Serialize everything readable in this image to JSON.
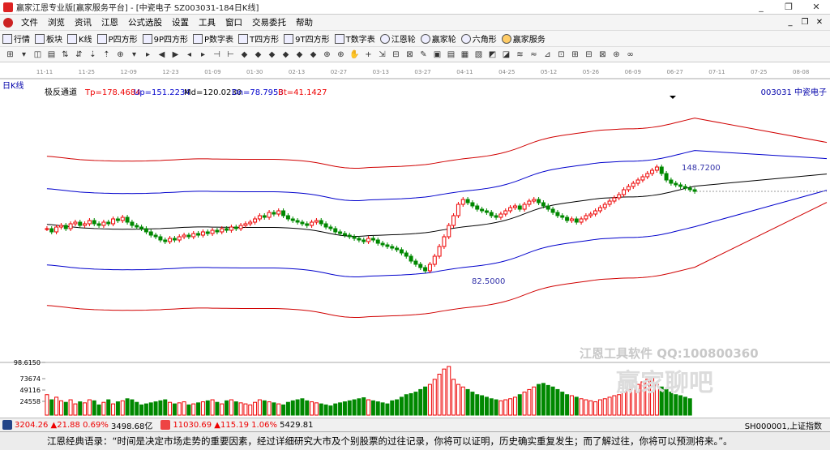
{
  "window": {
    "title": "赢家江恩专业版[赢家服务平台] - [中瓷电子  SZ003031-184日K线]",
    "controls": [
      "_",
      "❐",
      "✕"
    ]
  },
  "menu": {
    "items": [
      "文件",
      "浏览",
      "资讯",
      "江恩",
      "公式选股",
      "设置",
      "工具",
      "窗口",
      "交易委托",
      "帮助"
    ],
    "mdi": [
      "_",
      "❐",
      "✕"
    ]
  },
  "toolbar1": {
    "items": [
      {
        "label": "行情",
        "icon": "grid-icon"
      },
      {
        "label": "板块",
        "icon": "blocks-icon"
      },
      {
        "label": "K线",
        "icon": "candle-icon"
      },
      {
        "label": "P四方形",
        "icon": "p-square-icon"
      },
      {
        "label": "9P四方形",
        "icon": "9p-square-icon"
      },
      {
        "label": "P数字表",
        "icon": "p-table-icon"
      },
      {
        "label": "T四方形",
        "icon": "t-square-icon"
      },
      {
        "label": "9T四方形",
        "icon": "9t-square-icon"
      },
      {
        "label": "T数字表",
        "icon": "t-table-icon"
      },
      {
        "label": "江恩轮",
        "icon": "gann-wheel-icon"
      },
      {
        "label": "赢家轮",
        "icon": "winner-wheel-icon"
      },
      {
        "label": "六角形",
        "icon": "hexagon-icon"
      },
      {
        "label": "赢家服务",
        "icon": "service-icon"
      }
    ]
  },
  "toolbar2": {
    "glyphs": [
      "⊞",
      "▾",
      "◫",
      "▤",
      "⇅",
      "⇵",
      "⇣",
      "⇡",
      "⊕",
      "▾",
      "▸",
      "◀",
      "▶",
      "◂",
      "▸",
      "⊣",
      "⊢",
      "◆",
      "◆",
      "◆",
      "◆",
      "◆",
      "◆",
      "⊕",
      "⊕",
      "✋",
      "+",
      "⇲",
      "⊟",
      "⊠",
      "✎",
      "▣",
      "▤",
      "▦",
      "▧",
      "◩",
      "◪",
      "≋",
      "≈",
      "⊿",
      "⊡",
      "⊞",
      "⊟",
      "⊠",
      "⊛",
      "∞"
    ]
  },
  "chart_data": {
    "type": "candlestick",
    "period_label": "日K线",
    "indicator": {
      "name": "极反通道",
      "tp": "Tp=178.4684",
      "up": "Up=151.2234",
      "md": "Md=120.0230",
      "dn": "Dn=78.7953",
      "bt": "Bt=41.1427"
    },
    "stock_label": "003031 中瓷电子",
    "x_ticks": [
      "11-11",
      "11-25",
      "12-09",
      "12-23",
      "01-09",
      "01-30",
      "02-13",
      "02-27",
      "03-13",
      "03-27",
      "04-11",
      "04-25",
      "05-12",
      "05-26",
      "06-09",
      "06-27",
      "07-11",
      "07-25",
      "08-08"
    ],
    "annotations": {
      "high": "148.7200",
      "low": "82.5000"
    },
    "volume_scale": [
      "98.6150",
      "73674",
      "49116",
      "24558"
    ],
    "ylim": [
      30,
      190
    ],
    "closes": [
      110,
      108,
      111,
      112,
      110,
      113,
      114,
      112,
      113,
      115,
      113,
      112,
      114,
      113,
      116,
      115,
      117,
      114,
      112,
      111,
      110,
      108,
      106,
      105,
      103,
      102,
      104,
      103,
      105,
      106,
      105,
      107,
      106,
      108,
      107,
      109,
      108,
      110,
      109,
      111,
      110,
      112,
      113,
      114,
      116,
      118,
      117,
      120,
      119,
      121,
      118,
      116,
      115,
      114,
      113,
      112,
      114,
      115,
      113,
      111,
      110,
      108,
      107,
      106,
      105,
      104,
      103,
      102,
      104,
      103,
      101,
      100,
      99,
      98,
      97,
      95,
      93,
      90,
      88,
      86,
      84,
      88,
      93,
      99,
      105,
      112,
      118,
      125,
      128,
      126,
      124,
      122,
      121,
      120,
      118,
      117,
      119,
      121,
      123,
      124,
      122,
      125,
      127,
      128,
      126,
      124,
      122,
      120,
      118,
      117,
      115,
      116,
      114,
      116,
      118,
      119,
      121,
      123,
      125,
      127,
      129,
      131,
      134,
      136,
      138,
      140,
      142,
      144,
      146,
      148,
      144,
      140,
      138,
      137,
      136,
      135,
      134,
      133
    ],
    "volumes": [
      40,
      30,
      35,
      28,
      25,
      30,
      22,
      26,
      24,
      30,
      28,
      20,
      25,
      30,
      22,
      26,
      28,
      32,
      30,
      25,
      20,
      22,
      24,
      26,
      28,
      30,
      25,
      22,
      24,
      26,
      20,
      22,
      24,
      26,
      28,
      30,
      25,
      22,
      28,
      30,
      26,
      24,
      22,
      20,
      25,
      30,
      28,
      26,
      24,
      22,
      20,
      25,
      28,
      30,
      32,
      28,
      26,
      24,
      22,
      20,
      18,
      22,
      24,
      26,
      28,
      30,
      32,
      34,
      30,
      28,
      26,
      24,
      22,
      28,
      30,
      35,
      40,
      42,
      45,
      50,
      55,
      60,
      70,
      80,
      90,
      95,
      70,
      60,
      55,
      50,
      45,
      40,
      38,
      35,
      32,
      30,
      28,
      30,
      32,
      35,
      40,
      45,
      50,
      55,
      60,
      62,
      58,
      55,
      50,
      45,
      40,
      38,
      35,
      32,
      30,
      28,
      26,
      30,
      32,
      35,
      38,
      40,
      45,
      50,
      55,
      60,
      65,
      70,
      75,
      60,
      55,
      50,
      45,
      40,
      38,
      35,
      32
    ]
  },
  "status": {
    "sh_value": "3204.26",
    "sh_change": "▲21.88",
    "sh_pct": "0.69%",
    "sh_amount": "3498.68亿",
    "sz_value": "11030.69",
    "sz_change": "▲115.19",
    "sz_pct": "1.06%",
    "sz_amount": "5429.81",
    "right_label": "SH000001,上证指数"
  },
  "watermark": {
    "line1": "江恩工具软件  QQ:100800360",
    "line2": "赢家聊吧"
  },
  "quote_bar": "江恩经典语录：“时间是决定市场走势的重要因素，经过详细研究大市及个别股票的过往记录，你将可以证明，历史确实重复发生；而了解过往，你将可以预测将来。”。",
  "colors": {
    "up": "#ee0000",
    "down": "#008800",
    "channel_outer": "#d00000",
    "channel_inner": "#0000cc",
    "mid": "#000000"
  }
}
